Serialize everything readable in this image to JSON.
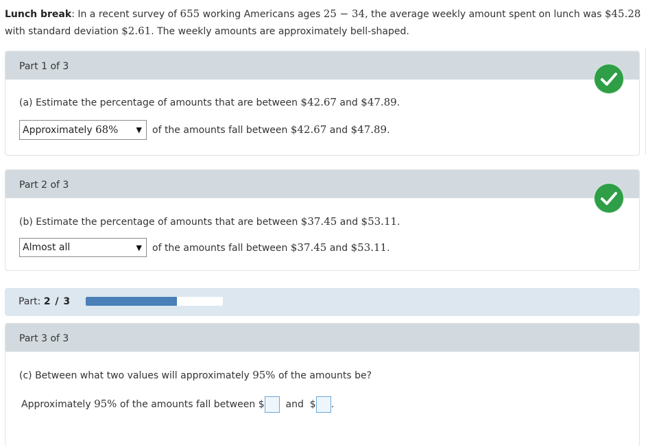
{
  "intro": {
    "title": "Lunch break",
    "t1": ": In a recent survey of ",
    "n": "655",
    "t2": " working Americans ages ",
    "ages": "25 − 34",
    "t3": ", the average weekly amount spent on lunch was ",
    "mean": "$45.28",
    "t4": "with standard deviation ",
    "sd": "$2.61",
    "t5": ". The weekly amounts are approximately bell-shaped."
  },
  "part1": {
    "header": "Part 1 of 3",
    "q_text": "(a) Estimate the percentage of amounts that are between ",
    "a": "$42.67",
    "and": " and ",
    "b": "$47.89",
    "period": ".",
    "select_prefix": "Approximately ",
    "select_pct": "68%",
    "after_text": "of the amounts fall between ",
    "status": "correct"
  },
  "part2": {
    "header": "Part 2 of 3",
    "q_text": "(b) Estimate the percentage of amounts that are between ",
    "a": "$37.45",
    "and": " and ",
    "b": "$53.11",
    "period": ".",
    "select_value": "Almost all",
    "after_text": "of the amounts fall between ",
    "status": "correct"
  },
  "progress": {
    "label": "Part: ",
    "value": "2 / 3",
    "fraction": 0.6667
  },
  "part3": {
    "header": "Part 3 of 3",
    "q_text": "(c) Between what two values will approximately ",
    "pct": "95%",
    "q_text2": " of the amounts be?",
    "ans_prefix": "Approximately ",
    "ans_mid": " of the amounts fall between ",
    "dollar": "$",
    "and": "and",
    "period": "."
  },
  "colors": {
    "check_green": "#2e9e47",
    "progress_fill": "#4a7fb8",
    "header_gray": "#d3dadf"
  },
  "icons": {
    "check": "check-circle-icon",
    "dropdown": "triangle-down-icon"
  }
}
